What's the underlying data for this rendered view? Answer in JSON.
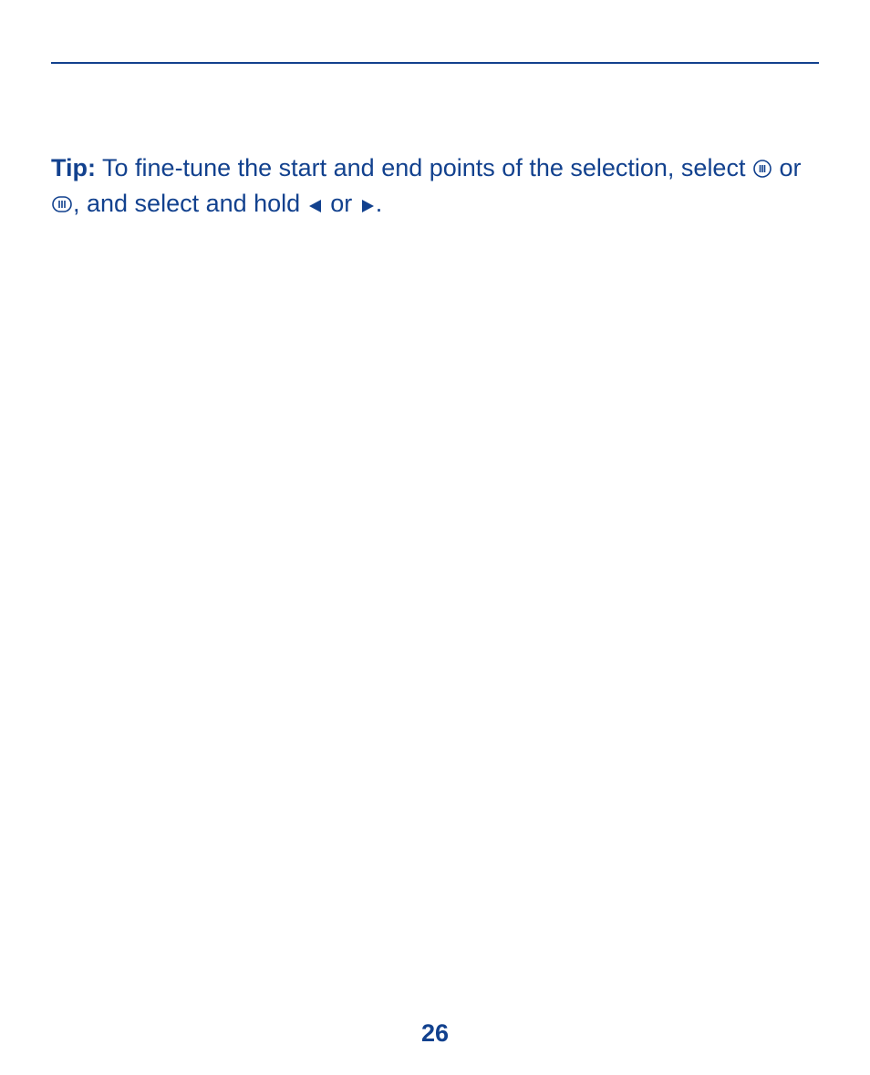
{
  "tip": {
    "label": "Tip:",
    "part1": " To fine-tune the start and end points of the selection, select ",
    "part2": " or ",
    "part3": ", and select and hold ",
    "part4": " or ",
    "part5": "."
  },
  "page_number": "26",
  "colors": {
    "primary": "#12418e"
  }
}
